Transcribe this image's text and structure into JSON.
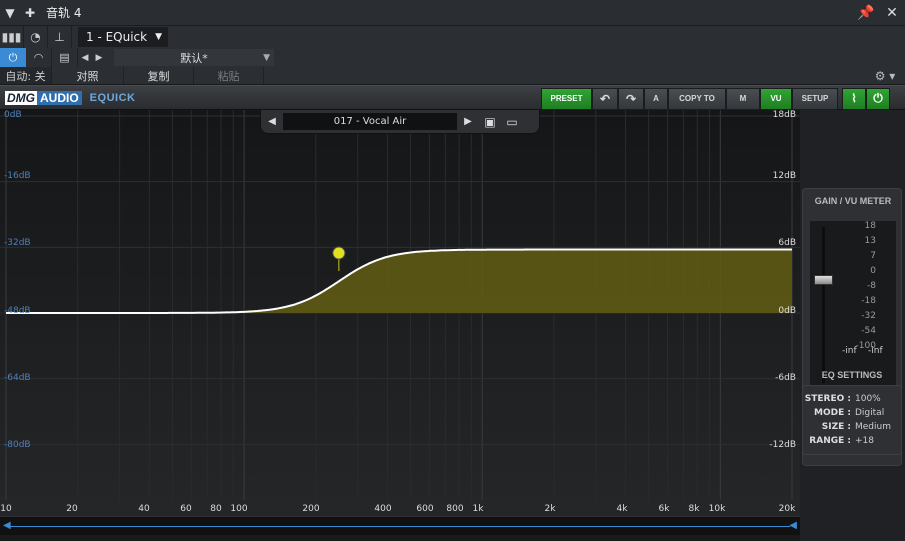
{
  "host": {
    "track_name": "音轨 4",
    "plugin_slot": "1 - EQuick",
    "preset_default": "默认*",
    "auto_label": "自动: 关",
    "compare_label": "对照",
    "copy_label": "复制",
    "paste_label": "粘贴"
  },
  "plugin": {
    "brand_dmg": "DMG",
    "brand_audio": "AUDIO",
    "product": "EQUICK",
    "buttons": {
      "preset": "PRESET",
      "undo": "↶",
      "redo": "↷",
      "ab": "A",
      "copy_to": "COPY TO",
      "m": "M",
      "vu": "VU",
      "setup": "SETUP"
    },
    "preset_name": "017 - Vocal Air"
  },
  "graph": {
    "left_db_labels": [
      "0dB",
      "-16dB",
      "-32dB",
      "-48dB",
      "-64dB",
      "-80dB"
    ],
    "right_db_labels": [
      "18dB",
      "12dB",
      "6dB",
      "0dB",
      "-6dB",
      "-12dB"
    ],
    "freq_labels": [
      "10",
      "20",
      "40",
      "60",
      "80",
      "100",
      "200",
      "400",
      "600",
      "800",
      "1k",
      "2k",
      "4k",
      "6k",
      "8k",
      "10k",
      "20k"
    ],
    "curve": {
      "type": "high-shelf",
      "freq_hz": 250,
      "gain_db": 5.8,
      "freq_range": [
        10,
        20000
      ],
      "gain_range_db": [
        -18,
        18
      ],
      "fill_color": "#5e5a14",
      "line_color": "#ffffff",
      "handle_color": "#e3e01d"
    }
  },
  "meter": {
    "title": "GAIN / VU METER",
    "scale": [
      "18",
      "13",
      "7",
      "0",
      "-8",
      "-18",
      "-32",
      "-54",
      "-100"
    ],
    "inf_left": "-inf",
    "inf_right": "-inf"
  },
  "eq_settings": {
    "title": "EQ SETTINGS",
    "rows": [
      {
        "key": "STEREO :",
        "value": "100%"
      },
      {
        "key": "MODE :",
        "value": "Digital"
      },
      {
        "key": "SIZE :",
        "value": "Medium"
      },
      {
        "key": "RANGE :",
        "value": "+18"
      }
    ]
  }
}
